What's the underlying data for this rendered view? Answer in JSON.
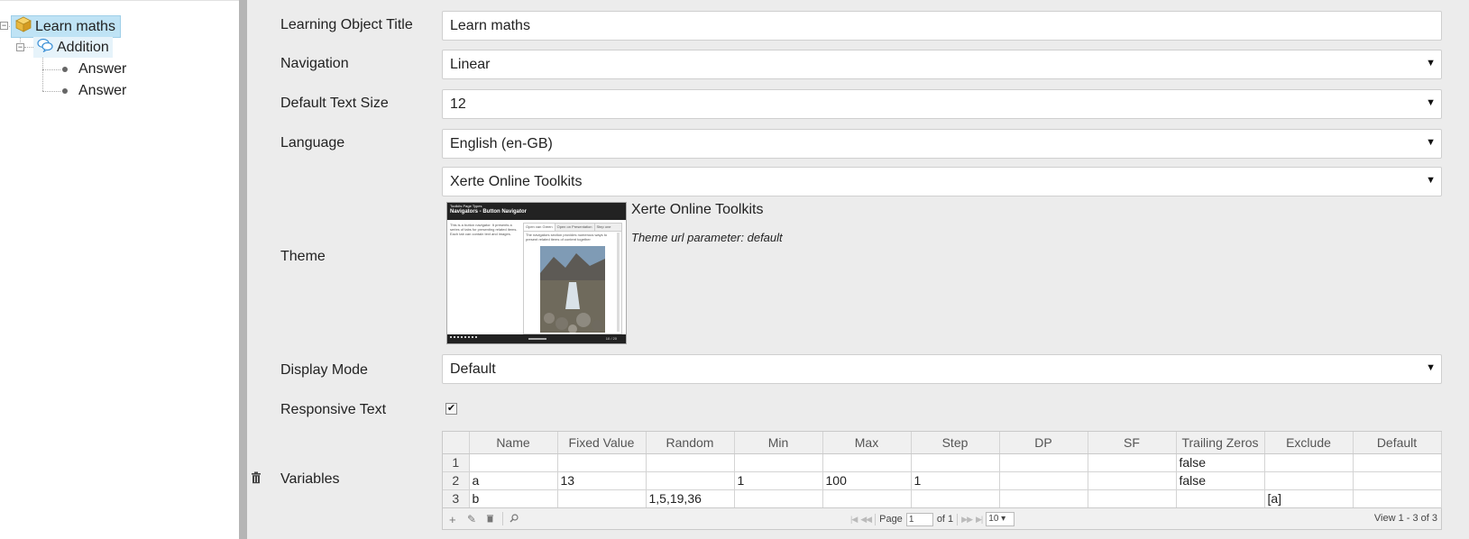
{
  "tree": {
    "root": {
      "label": "Learn maths",
      "icon": "package-icon"
    },
    "child": {
      "label": "Addition",
      "icon": "speech-bubbles-icon"
    },
    "leaves": [
      {
        "label": "Answer"
      },
      {
        "label": "Answer"
      }
    ]
  },
  "properties": {
    "title": {
      "label": "Learning Object Title",
      "value": "Learn maths"
    },
    "navigation": {
      "label": "Navigation",
      "value": "Linear"
    },
    "text_size": {
      "label": "Default Text Size",
      "value": "12"
    },
    "language": {
      "label": "Language",
      "value": "English (en-GB)"
    },
    "theme": {
      "label": "Theme",
      "value": "Xerte Online Toolkits",
      "name": "Xerte Online Toolkits",
      "url_param": "Theme url parameter: default",
      "preview": {
        "page_type": "Toolkits Page Types",
        "heading": "Navigators - Button Navigator",
        "body": "This is a button navigator. It presents a series of tabs for presenting related items. Each tab can contain text and images.",
        "tabs": [
          "Open van Green",
          "Open on Presentation",
          "Step one"
        ],
        "tab_body": "The navigators section provides numerous ways to present related items of content together",
        "page_counter": "10 / 20"
      }
    },
    "display_mode": {
      "label": "Display Mode",
      "value": "Default"
    },
    "responsive_text": {
      "label": "Responsive Text",
      "checked": true
    },
    "variables": {
      "label": "Variables",
      "columns": [
        "Name",
        "Fixed Value",
        "Random",
        "Min",
        "Max",
        "Step",
        "DP",
        "SF",
        "Trailing Zeros",
        "Exclude",
        "Default"
      ],
      "rows": [
        {
          "n": "1",
          "cells": [
            "",
            "",
            "",
            "",
            "",
            "",
            "",
            "",
            "false",
            "",
            ""
          ]
        },
        {
          "n": "2",
          "cells": [
            "a",
            "13",
            "",
            "1",
            "100",
            "1",
            "",
            "",
            "false",
            "",
            ""
          ]
        },
        {
          "n": "3",
          "cells": [
            "b",
            "",
            "1,5,19,36",
            "",
            "",
            "",
            "",
            "",
            "",
            "[a]",
            ""
          ]
        }
      ],
      "pager": {
        "page_label": "Page",
        "page_value": "1",
        "of_label": "of 1",
        "rows_per_page": "10",
        "view_info": "View 1 - 3 of 3"
      }
    }
  }
}
